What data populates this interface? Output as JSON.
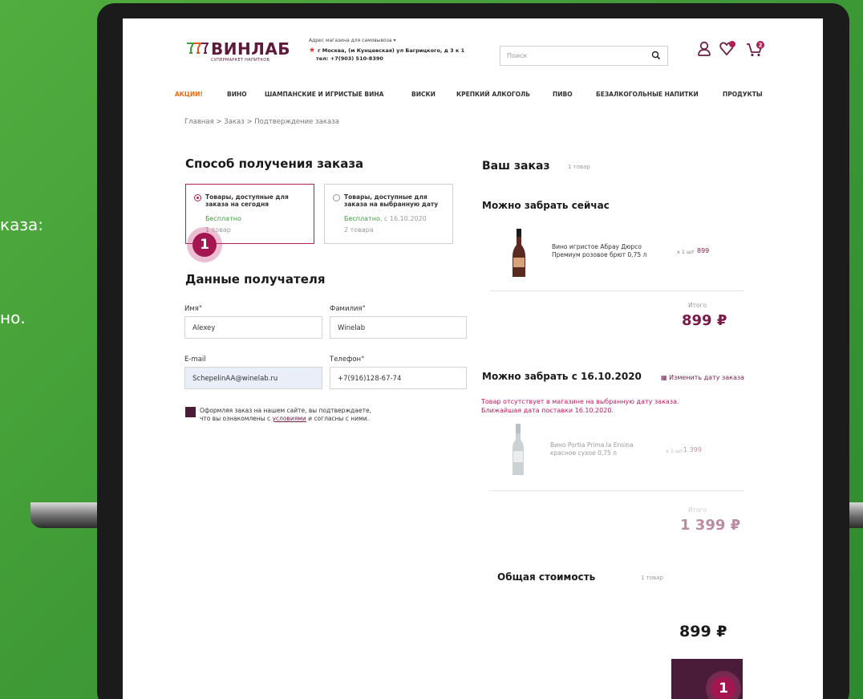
{
  "side_text": {
    "line1": "каза:",
    "line2": "но."
  },
  "store": {
    "logo": "ВИНЛАБ",
    "logo_sub": "СУПЕРМАРКЕТ НАПИТКОВ",
    "address_label": "Адрес магазина для самовывоза",
    "address": "г Москва, (м Кунцевская) ул Багрицкого, д 3 к 1",
    "phone": "тел: +7(903) 510-8390",
    "cart_count": "2",
    "colors": {
      "brand": "#5c1a3c",
      "accent": "#b01e53",
      "sale": "#e76a0c",
      "green": "#3c9b3c",
      "background": "#3f9a36"
    }
  },
  "search": {
    "placeholder": "Поиск"
  },
  "icons": [
    "chevron-down-icon",
    "star-icon",
    "search-icon",
    "user-icon",
    "heart-icon",
    "cart-icon",
    "calendar-icon",
    "checkbox-icon"
  ],
  "nav": {
    "items": [
      "АКЦИИ!",
      "ВИНО",
      "ШАМПАНСКИЕ И ИГРИСТЫЕ ВИНА",
      "ВИСКИ",
      "КРЕПКИЙ АЛКОГОЛЬ",
      "ПИВО",
      "БЕЗАЛКОГОЛЬНЫЕ НАПИТКИ",
      "ПРОДУКТЫ"
    ]
  },
  "breadcrumb": "Главная > Заказ > Подтверждение заказа",
  "delivery": {
    "title": "Способ получения заказа",
    "options": [
      {
        "title": "Товары, доступные для заказа на сегодня",
        "price": "Бесплатно",
        "count": "1 товар",
        "selected": true
      },
      {
        "title": "Товары, доступные для заказа на выбранную дату",
        "price": "Бесплатно",
        "date": ", с 16.10.2020",
        "count": "2 товара",
        "selected": false
      }
    ]
  },
  "recipient": {
    "title": "Данные получателя",
    "first_name_label": "Имя°",
    "first_name": "Alexey",
    "last_name_label": "Фамилия°",
    "last_name": "Winelab",
    "email_label": "E-mail",
    "email": "SchepelinAA@winelab.ru",
    "phone_label": "Телефон°",
    "phone": "+7(916)128-67-74",
    "consent_1": "Оформляя заказ на нашем сайте, вы подтверждаете,",
    "consent_2": "что вы ознакомлены с ",
    "consent_link": "условиями",
    "consent_3": " и согласны с ними."
  },
  "order": {
    "title": "Ваш заказ",
    "count": "1 товар",
    "now": {
      "title": "Можно забрать сейчас",
      "product_1": "Вино игристое Абрау Дюрсо",
      "product_2": "Премиум розовое брют 0,75 л",
      "qty": "х 1 шт",
      "price": "899",
      "total_label": "Итого",
      "total": "899 ₽"
    },
    "later": {
      "title": "Можно забрать с 16.10.2020",
      "change_date": "Изменить дату заказа",
      "warning_1": "Товар отсутствует в магазине на выбранную дату заказа.",
      "warning_2": "Ближайшая дата поставки 16.10.2020.",
      "product_1": "Вино Portia Prima la Ensina",
      "product_2": "красное сухое 0,75 л",
      "qty": "х 1 шт",
      "price": "1 399",
      "total_label": "Итого",
      "total": "1 399 ₽"
    },
    "grand": {
      "title": "Общая стоимость",
      "count": "1 товар",
      "total": "899 ₽"
    }
  },
  "markers": {
    "badge_1": "1",
    "badge_2": "1"
  }
}
